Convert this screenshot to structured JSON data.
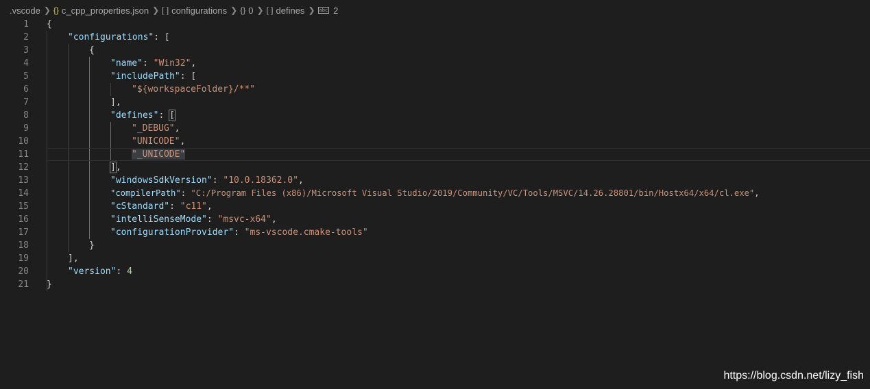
{
  "breadcrumb": {
    "items": [
      {
        "label": ".vscode",
        "icon": ""
      },
      {
        "label": "c_cpp_properties.json",
        "icon": "{}"
      },
      {
        "label": "configurations",
        "icon": "[ ]"
      },
      {
        "label": "0",
        "icon": "{}"
      },
      {
        "label": "defines",
        "icon": "[ ]"
      },
      {
        "label": "2",
        "icon": "abc"
      }
    ]
  },
  "editor": {
    "line_numbers": [
      "1",
      "2",
      "3",
      "4",
      "5",
      "6",
      "7",
      "8",
      "9",
      "10",
      "11",
      "12",
      "13",
      "14",
      "15",
      "16",
      "17",
      "18",
      "19",
      "20",
      "21"
    ],
    "code": {
      "l1_open": "{",
      "l2_key": "\"configurations\"",
      "l2_rest": ": [",
      "l3_open": "{",
      "l4_key": "\"name\"",
      "l4_colon": ": ",
      "l4_val": "\"Win32\"",
      "l4_comma": ",",
      "l5_key": "\"includePath\"",
      "l5_rest": ": [",
      "l6_val": "\"${workspaceFolder}/**\"",
      "l7_close": "],",
      "l8_key": "\"defines\"",
      "l8_colon": ": ",
      "l8_bracket": "[",
      "l9_val": "\"_DEBUG\"",
      "l9_comma": ",",
      "l10_val": "\"UNICODE\"",
      "l10_comma": ",",
      "l11_val": "\"_UNICODE\"",
      "l12_bracket": "]",
      "l12_comma": ",",
      "l13_key": "\"windowsSdkVersion\"",
      "l13_colon": ": ",
      "l13_val": "\"10.0.18362.0\"",
      "l13_comma": ",",
      "l14_key": "\"compilerPath\"",
      "l14_colon": ": ",
      "l14_val": "\"C:/Program Files (x86)/Microsoft Visual Studio/2019/Community/VC/Tools/MSVC/14.26.28801/bin/Hostx64/x64/cl.exe\"",
      "l14_comma": ",",
      "l15_key": "\"cStandard\"",
      "l15_colon": ": ",
      "l15_val": "\"c11\"",
      "l15_comma": ",",
      "l16_key": "\"intelliSenseMode\"",
      "l16_colon": ": ",
      "l16_val": "\"msvc-x64\"",
      "l16_comma": ",",
      "l17_key": "\"configurationProvider\"",
      "l17_colon": ": ",
      "l17_val": "\"ms-vscode.cmake-tools\"",
      "l18_close": "}",
      "l19_close": "],",
      "l20_key": "\"version\"",
      "l20_colon": ": ",
      "l20_val": "4",
      "l21_close": "}"
    }
  },
  "watermark": "https://blog.csdn.net/lizy_fish",
  "colors": {
    "background": "#1e1e1e",
    "key": "#9cdcfe",
    "string": "#ce9178",
    "number": "#b5cea8",
    "line_number": "#858585"
  }
}
